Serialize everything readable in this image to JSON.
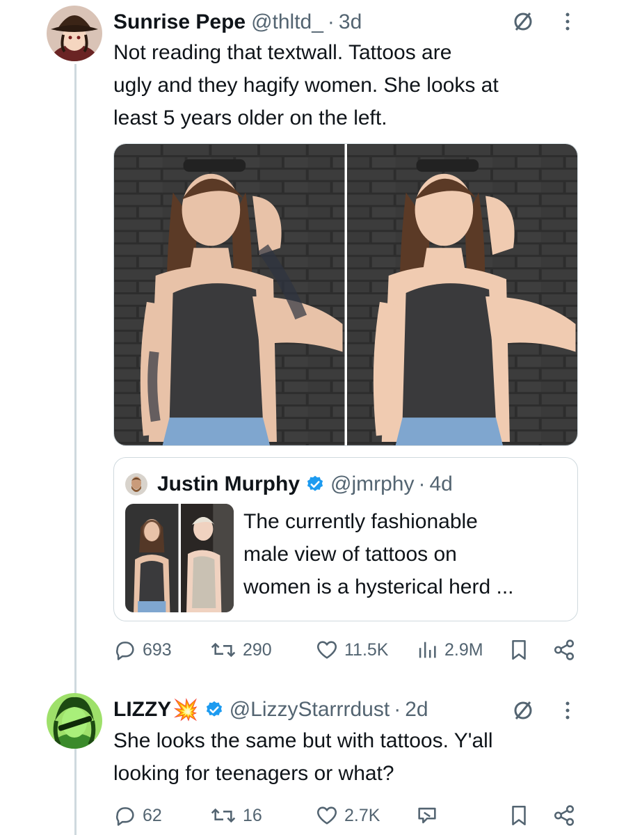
{
  "tweets": [
    {
      "name": "Sunrise Pepe",
      "handle": "@thltd_",
      "separator": "·",
      "time": "3d",
      "text_lines": [
        "Not reading that textwall. Tattoos are",
        "ugly and they hagify women. She looks at",
        "least 5 years older on the left."
      ],
      "quote": {
        "name": "Justin Murphy",
        "handle": "@jmrphy",
        "separator": "·",
        "time": "4d",
        "text_lines": [
          "The currently fashionable",
          "male view of tattoos on",
          "women is a hysterical herd ..."
        ]
      },
      "stats": {
        "replies": "693",
        "reposts": "290",
        "likes": "11.5K",
        "views": "2.9M"
      }
    },
    {
      "name": "LIZZY",
      "name_emoji": "💥",
      "handle": "@LizzyStarrrdust",
      "separator": "·",
      "time": "2d",
      "text_lines": [
        "She looks the same but with tattoos. Y'all",
        "looking for teenagers or what?"
      ],
      "stats": {
        "replies": "62",
        "reposts": "16",
        "likes": "2.7K"
      }
    }
  ],
  "icons": {
    "muted": "muted-icon",
    "more": "more-dots-icon",
    "reply": "reply-bubble-icon",
    "repost": "repost-icon",
    "like": "heart-icon",
    "views": "views-bar-icon",
    "bookmark": "bookmark-icon",
    "share": "share-icon",
    "grok": "grok-icon",
    "verified": "verified-badge-icon"
  },
  "colors": {
    "text": "#0f1419",
    "secondary": "#536471",
    "verified": "#1d9bf0",
    "border": "#cfd9de"
  }
}
